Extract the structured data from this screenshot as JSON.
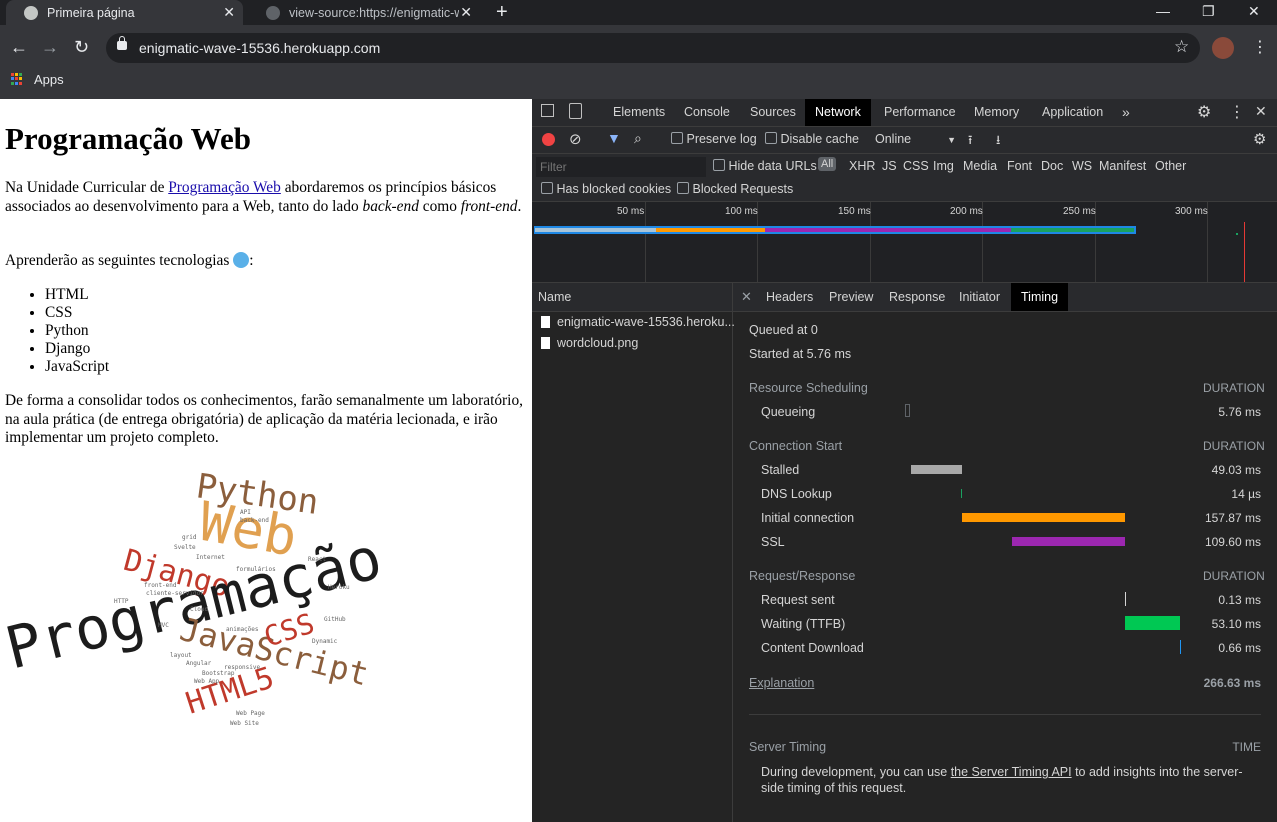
{
  "browser": {
    "tabs": [
      {
        "title": "Primeira página",
        "active": true
      },
      {
        "title": "view-source:https://enigmatic-wa",
        "active": false
      }
    ],
    "url": "enigmatic-wave-15536.herokuapp.com",
    "bookmarks": {
      "apps_label": "Apps"
    }
  },
  "page": {
    "heading": "Programação Web",
    "intro_before": "Na Unidade Curricular de ",
    "intro_link": "Programação Web",
    "intro_after": " abordaremos os princípios básicos associados ao desenvolvimento para a Web, tanto do lado ",
    "intro_em1": "back-end",
    "intro_mid": " como ",
    "intro_em2": "front-end",
    "intro_end": ".",
    "tech_intro": "Aprenderão as seguintes tecnologias",
    "tech_colon": ":",
    "technologies": [
      "HTML",
      "CSS",
      "Python",
      "Django",
      "JavaScript"
    ],
    "closing": "De forma a consolidar todos os conhecimentos, farão semanalmente um laboratório, na aula prática (de entrega obrigatória) de aplicação da matéria lecionada, e irão implementar um projeto completo.",
    "wordcloud": {
      "main_words": [
        "Programação",
        "Web",
        "Python",
        "Django",
        "JavaScript",
        "CSS",
        "HTML5"
      ],
      "small_words": [
        "API",
        "back-end",
        "grid",
        "Svelte",
        "Internet",
        "formulários",
        "React",
        "front-end",
        "cliente-servidor",
        "HTTP",
        "MVC",
        "Cloud",
        "Heroku",
        "GitHub",
        "animações",
        "Dynamic",
        "layout",
        "Angular",
        "responsive",
        "Bootstrap",
        "Web App",
        "Web Page",
        "Web Site"
      ]
    }
  },
  "devtools": {
    "panel_tabs": [
      "Elements",
      "Console",
      "Sources",
      "Network",
      "Performance",
      "Memory",
      "Application"
    ],
    "selected_panel": "Network",
    "more_tabs": "»",
    "toolbar": {
      "preserve_log": "Preserve log",
      "disable_cache": "Disable cache",
      "throttle": "Online"
    },
    "filter": {
      "placeholder": "Filter",
      "hide_data_urls": "Hide data URLs",
      "types": [
        "All",
        "XHR",
        "JS",
        "CSS",
        "Img",
        "Media",
        "Font",
        "Doc",
        "WS",
        "Manifest",
        "Other"
      ],
      "has_blocked_cookies": "Has blocked cookies",
      "blocked_requests": "Blocked Requests"
    },
    "timeline_ticks": [
      "50 ms",
      "100 ms",
      "150 ms",
      "200 ms",
      "250 ms",
      "300 ms"
    ],
    "requests": {
      "header": "Name",
      "items": [
        "enigmatic-wave-15536.heroku...",
        "wordcloud.png"
      ]
    },
    "detail_tabs": [
      "Headers",
      "Preview",
      "Response",
      "Initiator",
      "Timing"
    ],
    "selected_detail_tab": "Timing",
    "timing": {
      "queued_at": "Queued at 0",
      "started_at": "Started at 5.76 ms",
      "duration_label": "DURATION",
      "sections": [
        {
          "title": "Resource Scheduling",
          "rows": [
            {
              "label": "Queueing",
              "value": "5.76 ms",
              "color": "#5f6368"
            }
          ]
        },
        {
          "title": "Connection Start",
          "rows": [
            {
              "label": "Stalled",
              "value": "49.03 ms",
              "color": "#a8a8a8"
            },
            {
              "label": "DNS Lookup",
              "value": "14 µs",
              "color": "#1aa260"
            },
            {
              "label": "Initial connection",
              "value": "157.87 ms",
              "color": "#ff9800"
            },
            {
              "label": "SSL",
              "value": "109.60 ms",
              "color": "#9c27b0"
            }
          ]
        },
        {
          "title": "Request/Response",
          "rows": [
            {
              "label": "Request sent",
              "value": "0.13 ms",
              "color": "#d5d5d5"
            },
            {
              "label": "Waiting (TTFB)",
              "value": "53.10 ms",
              "color": "#00c853"
            },
            {
              "label": "Content Download",
              "value": "0.66 ms",
              "color": "#2196f3"
            }
          ]
        }
      ],
      "explanation": "Explanation",
      "total": "266.63 ms",
      "server_timing_title": "Server Timing",
      "server_timing_time": "TIME",
      "server_text_before": "During development, you can use ",
      "server_text_link": "the Server Timing API",
      "server_text_after": " to add insights into the server-side timing of this request."
    }
  }
}
